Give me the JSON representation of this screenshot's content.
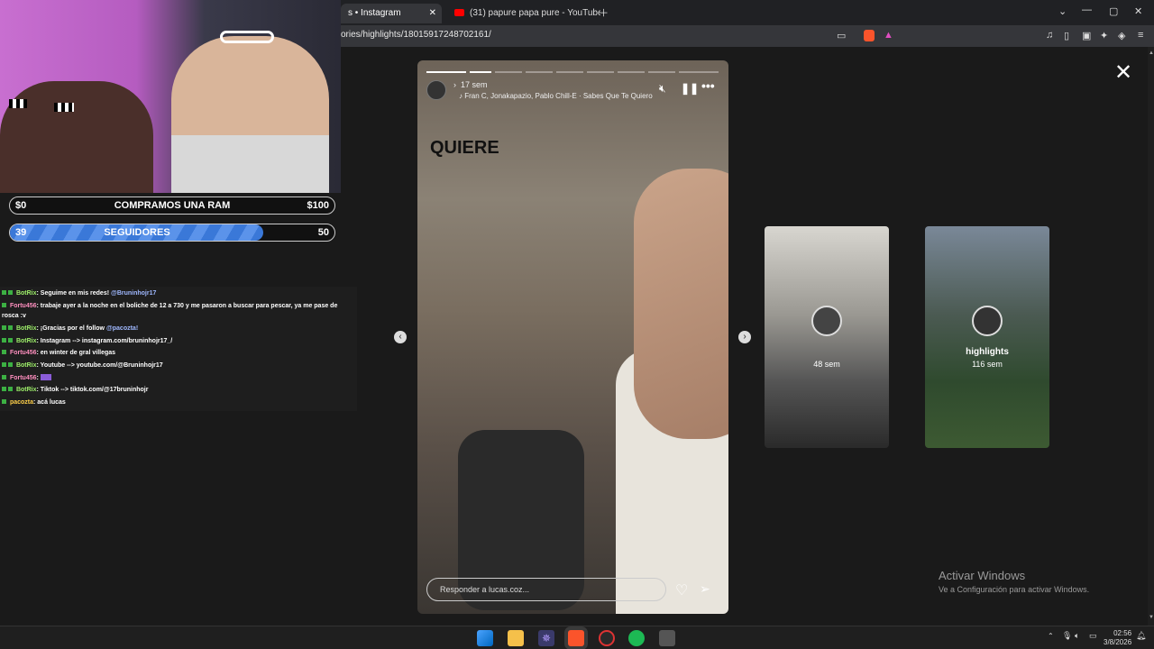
{
  "browser": {
    "tabs": [
      {
        "label": "s • Instagram"
      },
      {
        "label": "(31) papure papa pure - YouTube"
      }
    ],
    "url": "ories/highlights/18015917248702161/"
  },
  "story": {
    "time": "17 sem",
    "song": "Fran C, Jonakapazio, Pablo Chill-E · Sabes Que Te Quiero",
    "caption": "QUIERE",
    "reply_placeholder": "Responder a lucas.coz..."
  },
  "highlights": [
    {
      "time": "48 sem"
    },
    {
      "title": "highlights",
      "time": "116 sem"
    }
  ],
  "watermark": {
    "line1": "Activar Windows",
    "line2": "Ve a Configuración para activar Windows."
  },
  "stream": {
    "goal1": {
      "left": "$0",
      "label": "COMPRAMOS UNA RAM",
      "right": "$100"
    },
    "goal2": {
      "left": "39",
      "label": "SEGUIDORES",
      "right": "50",
      "progress": 0.78
    },
    "chat": [
      {
        "user": "BotRix",
        "text": ": Seguime en mis redes!",
        "mention": "@Bruninhojr17"
      },
      {
        "user": "Fortu456",
        "text": ": trabaje ayer a la noche en el boliche de 12 a 730 y me pasaron a buscar para pescar, ya me pase de"
      },
      {
        "user": "",
        "text": "rosca :v"
      },
      {
        "user": "BotRix",
        "text": ": ¡Gracias por el follow",
        "mention": "@pacozta!"
      },
      {
        "user": "BotRix",
        "text": ": Instagram --> instagram.com/bruninhojr17_/"
      },
      {
        "user": "Fortu456",
        "text": ": en winter de gral villegas"
      },
      {
        "user": "BotRix",
        "text": ": Youtube --> youtube.com/@Bruninhojr17"
      },
      {
        "user": "Fortu456",
        "text": ":"
      },
      {
        "user": "BotRix",
        "text": ": Tiktok --> tiktok.com/@17bruninhojr"
      },
      {
        "user": "pacozta",
        "text": ": acá lucas"
      }
    ]
  },
  "taskbar": {
    "time": "02:56",
    "date": "3/8/2026"
  }
}
